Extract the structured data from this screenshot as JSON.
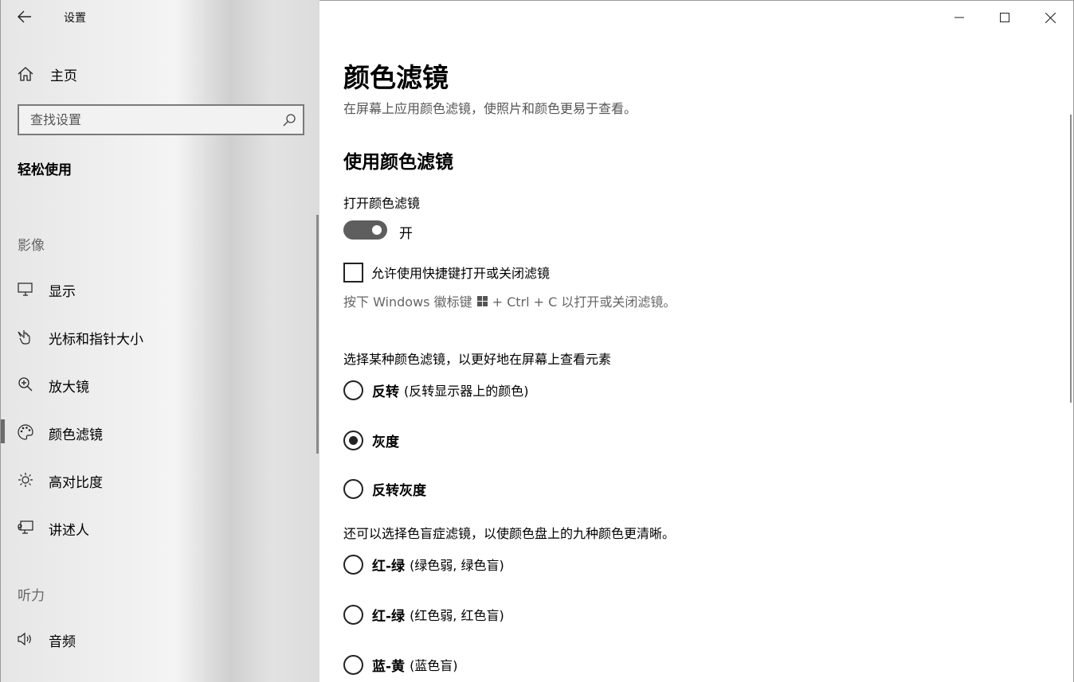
{
  "app": {
    "title": "设置"
  },
  "sidebar": {
    "home_label": "主页",
    "search_placeholder": "查找设置",
    "section_title": "轻松使用",
    "group_vision": "影像",
    "group_hearing": "听力",
    "items": [
      {
        "label": "显示",
        "icon": "monitor-icon"
      },
      {
        "label": "光标和指针大小",
        "icon": "pointer-icon"
      },
      {
        "label": "放大镜",
        "icon": "magnifier-icon"
      },
      {
        "label": "颜色滤镜",
        "icon": "palette-icon",
        "active": true
      },
      {
        "label": "高对比度",
        "icon": "sun-icon"
      },
      {
        "label": "讲述人",
        "icon": "narrator-icon"
      },
      {
        "label": "音频",
        "icon": "speaker-icon"
      }
    ]
  },
  "main": {
    "title": "颜色滤镜",
    "description": "在屏幕上应用颜色滤镜，使照片和颜色更易于查看。",
    "subtitle": "使用颜色滤镜",
    "toggle_label": "打开颜色滤镜",
    "toggle_state": "开",
    "shortcut_checkbox_label": "允许使用快捷键打开或关闭滤镜",
    "shortcut_hint_before": "按下 Windows 徽标键",
    "shortcut_hint_after": "+ Ctrl + C 以打开或关闭滤镜。",
    "filter_prompt": "选择某种颜色滤镜，以更好地在屏幕上查看元素",
    "filters": [
      {
        "name": "反转",
        "desc": "(反转显示器上的颜色)",
        "checked": false
      },
      {
        "name": "灰度",
        "desc": "",
        "checked": true
      },
      {
        "name": "反转灰度",
        "desc": "",
        "checked": false
      }
    ],
    "colorblind_prompt": "还可以选择色盲症滤镜，以使颜色盘上的九种颜色更清晰。",
    "colorblind_filters": [
      {
        "name": "红-绿",
        "desc": "(绿色弱, 绿色盲)",
        "checked": false
      },
      {
        "name": "红-绿",
        "desc": "(红色弱, 红色盲)",
        "checked": false
      },
      {
        "name": "蓝-黄",
        "desc": "(蓝色盲)",
        "checked": false
      }
    ]
  }
}
